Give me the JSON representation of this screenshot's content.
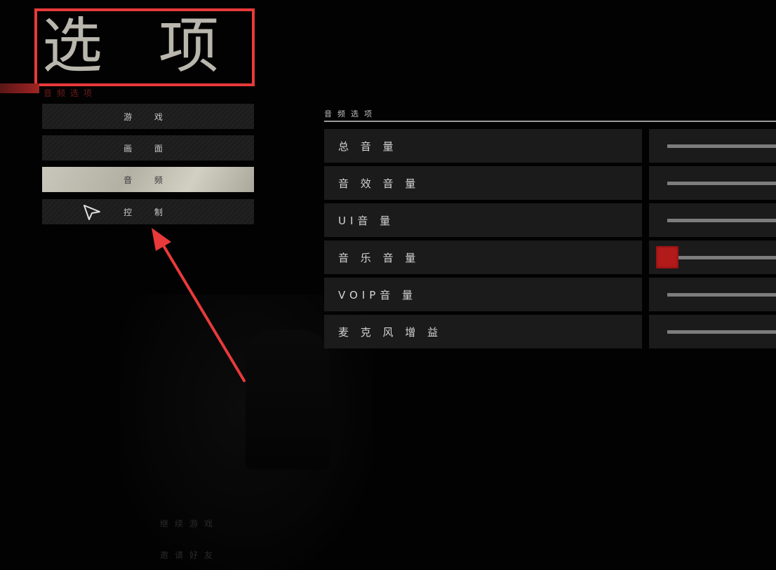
{
  "page": {
    "title": "选项",
    "subtitle": "音频选项"
  },
  "menu": {
    "items": [
      {
        "label": "游 戏",
        "active": false
      },
      {
        "label": "画 面",
        "active": false
      },
      {
        "label": "音 频",
        "active": true
      },
      {
        "label": "控 制",
        "active": false
      }
    ]
  },
  "bottom_links": {
    "link1": "继续游戏",
    "link2": "邀请好友"
  },
  "panel": {
    "title": "音频选项",
    "settings": [
      {
        "label": "总 音 量",
        "value_fraction": 1.0
      },
      {
        "label": "音 效 音 量",
        "value_fraction": 1.0
      },
      {
        "label": "UI音 量",
        "value_fraction": 1.0
      },
      {
        "label": "音 乐 音 量",
        "value_fraction": 0.0
      },
      {
        "label": "VOIP音 量",
        "value_fraction": 1.0
      },
      {
        "label": "麦 克 风 增 益",
        "value_fraction": 1.0
      }
    ]
  },
  "colors": {
    "highlight_box": "#e83a3a",
    "slider_handle": "#b31b1b",
    "active_menu": "#c9c7bb"
  },
  "icons": {
    "cursor": "mouse-pointer-icon",
    "annotation": "red-arrow-icon"
  }
}
